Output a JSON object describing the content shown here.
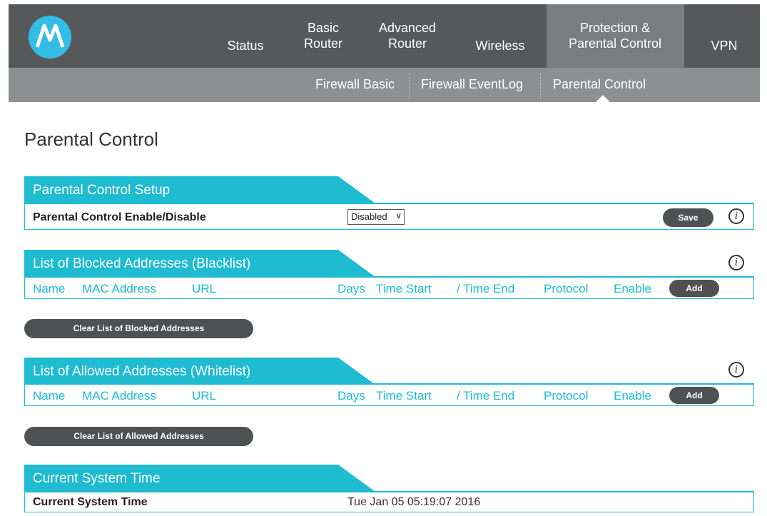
{
  "nav": {
    "items": [
      {
        "label": "Status"
      },
      {
        "label": "Basic\nRouter"
      },
      {
        "label": "Advanced\nRouter"
      },
      {
        "label": "Wireless"
      },
      {
        "label": "Protection &\nParental Control"
      },
      {
        "label": "VPN"
      }
    ],
    "active_index": 4
  },
  "subnav": {
    "items": [
      {
        "label": "Firewall Basic"
      },
      {
        "label": "Firewall EventLog"
      },
      {
        "label": "Parental Control"
      }
    ],
    "active_index": 2
  },
  "page": {
    "title": "Parental Control"
  },
  "setup": {
    "header": "Parental Control Setup",
    "row_label": "Parental Control Enable/Disable",
    "select_value": "Disabled",
    "save_label": "Save"
  },
  "blacklist": {
    "header": "List of Blocked Addresses (Blacklist)",
    "columns": [
      "Name",
      "MAC Address",
      "URL",
      "Days",
      "Time Start",
      "/ Time End",
      "Protocol",
      "Enable"
    ],
    "add_label": "Add",
    "clear_label": "Clear List of Blocked Addresses"
  },
  "whitelist": {
    "header": "List of Allowed Addresses (Whitelist)",
    "columns": [
      "Name",
      "MAC Address",
      "URL",
      "Days",
      "Time Start",
      "/ Time End",
      "Protocol",
      "Enable"
    ],
    "add_label": "Add",
    "clear_label": "Clear List of Allowed Addresses"
  },
  "system_time": {
    "header": "Current System Time",
    "row_label": "Current System Time",
    "value": "Tue Jan 05 05:19:07 2016"
  },
  "info_glyph": "i",
  "colors": {
    "nav_bg": "#57585a",
    "nav_active": "#7b7c7e",
    "subnav_bg": "#8e8f91",
    "accent": "#1ebbd1",
    "logo": "#33bde6",
    "button": "#505153"
  }
}
